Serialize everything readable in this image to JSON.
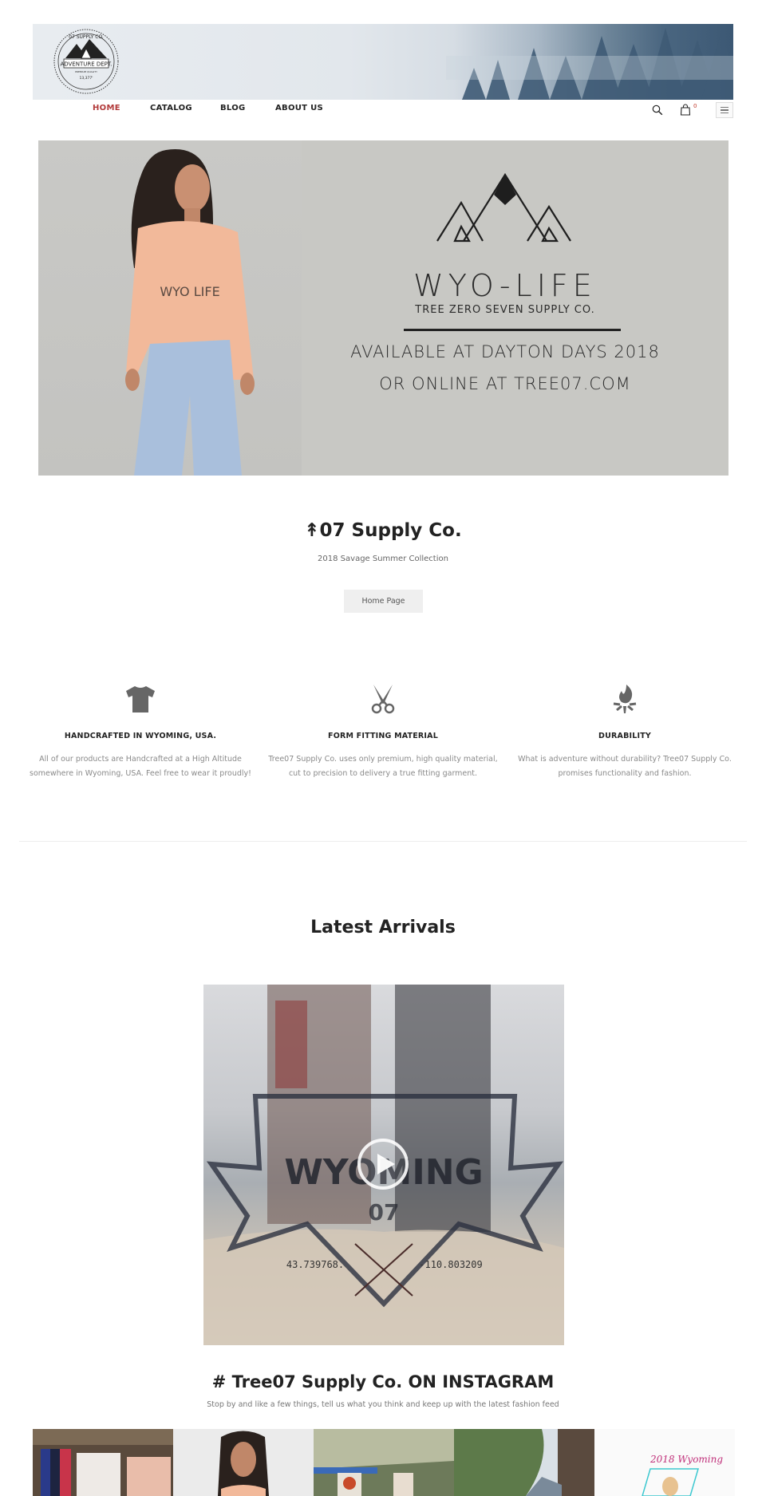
{
  "header": {
    "logo": {
      "top_text": "07 SUPPLY CO.",
      "band_text": "ADVENTURE DEPT.",
      "quality_text": "PREMIUM QUALITY",
      "elevation": "13,377'"
    },
    "nav": [
      {
        "label": "HOME",
        "active": true
      },
      {
        "label": "CATALOG",
        "active": false
      },
      {
        "label": "BLOG",
        "active": false
      },
      {
        "label": "ABOUT US",
        "active": false
      }
    ],
    "cart_count": "0",
    "icons": [
      "search-icon",
      "cart-icon",
      "menu-icon"
    ]
  },
  "hero": {
    "brand": "WYO-LIFE",
    "brand_sub": "TREE ZERO SEVEN SUPPLY CO.",
    "line1": "AVAILABLE AT DAYTON DAYS 2018",
    "line2": "OR ONLINE AT TREE07.COM",
    "shirt_text": "WYO LIFE"
  },
  "intro": {
    "title": "↟07 Supply Co.",
    "subtitle": "2018 Savage Summer Collection",
    "button_label": "Home Page"
  },
  "features": [
    {
      "icon": "tshirt-icon",
      "title": "HANDCRAFTED IN WYOMING, USA.",
      "text": "All of our products are Handcrafted at a High Altitude somewhere in Wyoming, USA. Feel free to wear it proudly!"
    },
    {
      "icon": "scissors-icon",
      "title": "FORM FITTING MATERIAL",
      "text": "Tree07 Supply Co. uses only premium, high quality material, cut to precision to delivery a true fitting garment."
    },
    {
      "icon": "campfire-icon",
      "title": "DURABILITY",
      "text": "What is adventure without durability? Tree07 Supply Co. promises functionality and fashion."
    }
  ],
  "latest": {
    "title": "Latest Arrivals",
    "video": {
      "badge_text": "WYOMING",
      "badge_num": "07",
      "coords_left": "43.739768.",
      "coords_right": "-110.803209"
    }
  },
  "instagram": {
    "title": "# Tree07 Supply Co. ON INSTAGRAM",
    "subtitle": "Stop by and like a few things, tell us what you think and keep up with the latest fashion feed",
    "items": [
      {
        "alt": "Merch display rack"
      },
      {
        "alt": "Model in hoodie"
      },
      {
        "alt": "Vendor tent booth"
      },
      {
        "alt": "Lake and trees"
      },
      {
        "alt": "2018 Wyoming",
        "caption": "2018 Wyoming"
      }
    ]
  },
  "colors": {
    "accent": "#b23a3a",
    "text": "#222222",
    "muted": "#8a8a8a",
    "hero_bg": "#c8c8c4",
    "button_bg": "#efefef"
  }
}
